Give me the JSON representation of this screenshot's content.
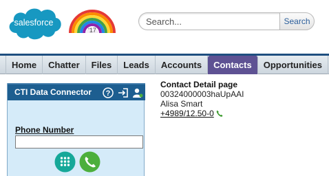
{
  "header": {
    "brand_name": "salesforce",
    "anniversary_label": "'17",
    "search": {
      "placeholder": "Search...",
      "value": "",
      "button_label": "Search"
    }
  },
  "tabs": [
    {
      "label": "Home"
    },
    {
      "label": "Chatter"
    },
    {
      "label": "Files"
    },
    {
      "label": "Leads"
    },
    {
      "label": "Accounts"
    },
    {
      "label": "Contacts",
      "active": true
    },
    {
      "label": "Opportunities"
    }
  ],
  "cti": {
    "title": "CTI Data Connector",
    "icons": [
      "help-icon",
      "login-icon",
      "user-status-icon"
    ],
    "phone_label": "Phone Number",
    "phone_value": "",
    "dialpad_icon": "dialpad-icon",
    "call_icon": "call-icon"
  },
  "contact": {
    "page_title": "Contact Detail page",
    "record_id": "00324000003haUpAAI",
    "name": "Alisa Smart",
    "phone": "+4989/12.50-0",
    "phone_icon": "phone-icon"
  },
  "colors": {
    "brand_blue": "#1798c1",
    "tab_active": "#5e5293",
    "cti_header": "#1d5e90",
    "cti_body": "#d5ebf9",
    "call_green": "#4caf3c"
  }
}
